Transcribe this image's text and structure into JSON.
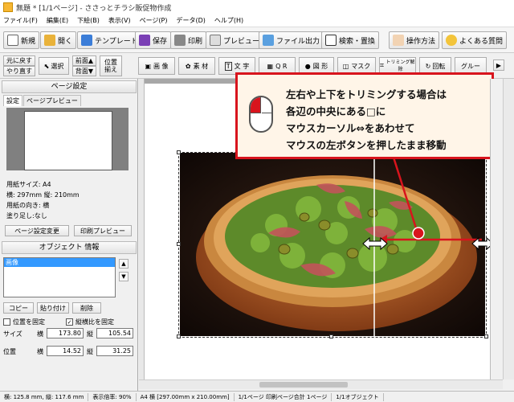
{
  "window": {
    "title": "無題 * [1/1ページ] - ささっとチラシ販促物作成"
  },
  "menu": [
    "ファイル(F)",
    "編集(E)",
    "下絵(B)",
    "表示(V)",
    "ページ(P)",
    "データ(D)",
    "ヘルプ(H)"
  ],
  "toolbar": {
    "new": "新規",
    "open": "開く",
    "template": "テンプレート",
    "save": "保存",
    "print": "印刷",
    "preview": "プレビュー",
    "file_output": "ファイル出力",
    "search_replace": "検索・置換",
    "howto": "操作方法",
    "faq": "よくある質問"
  },
  "toolbar2": {
    "undo": "元に戻す",
    "redo": "やり直す",
    "select": "選択",
    "front": "前面▲",
    "back": "背面▼",
    "align1": "位置",
    "align2": "揃え",
    "image": "画 像",
    "material": "素 材",
    "text": "文 字",
    "qr": "Q R",
    "shape": "図 形",
    "mask": "マスク",
    "trim": "トリミング解除",
    "rotate": "回転",
    "group": "グルー"
  },
  "left_panel": {
    "page_settings_header": "ページ設定",
    "tab_settings": "設定",
    "tab_preview": "ページプレビュー",
    "paper_size": "用紙サイズ: A4",
    "dimensions": "横: 297mm 縦: 210mm",
    "orientation": "用紙の向き: 横",
    "bleed": "塗り足し:なし",
    "page_settings_change": "ページ設定変更",
    "print_preview": "印刷プレビュー",
    "object_info_header": "オブジェクト 情報",
    "object_list": [
      "画像"
    ],
    "copy": "コピー",
    "paste": "貼り付け",
    "delete": "削除",
    "fix_position": "位置を固定",
    "fix_aspect": "縦横比を固定",
    "size_label": "サイズ",
    "pos_label": "位置",
    "h_label": "横",
    "v_label": "縦",
    "size_w": "173.80",
    "size_h": "105.54",
    "pos_x": "14.52",
    "pos_y": "31.25"
  },
  "callout": {
    "line1": "左右や上下をトリミングする場合は",
    "line2": "各辺の中央にある□に",
    "line3": "マウスカーソル⇔をあわせて",
    "line4": "マウスの左ボタンを押したまま移動"
  },
  "statusbar": {
    "cursor": "横: 125.8 mm, 縦: 117.6 mm",
    "zoom": "表示倍率: 90%",
    "paper": "A4 横 [297.00mm x 210.00mm]",
    "pages": "1/1ページ 印刷ページ合計 1ページ",
    "objects": "1/1オブジェクト"
  },
  "colors": {
    "accent": "#d8141d",
    "callout_bg": "#fff5e8",
    "selection": "#3399ff"
  }
}
